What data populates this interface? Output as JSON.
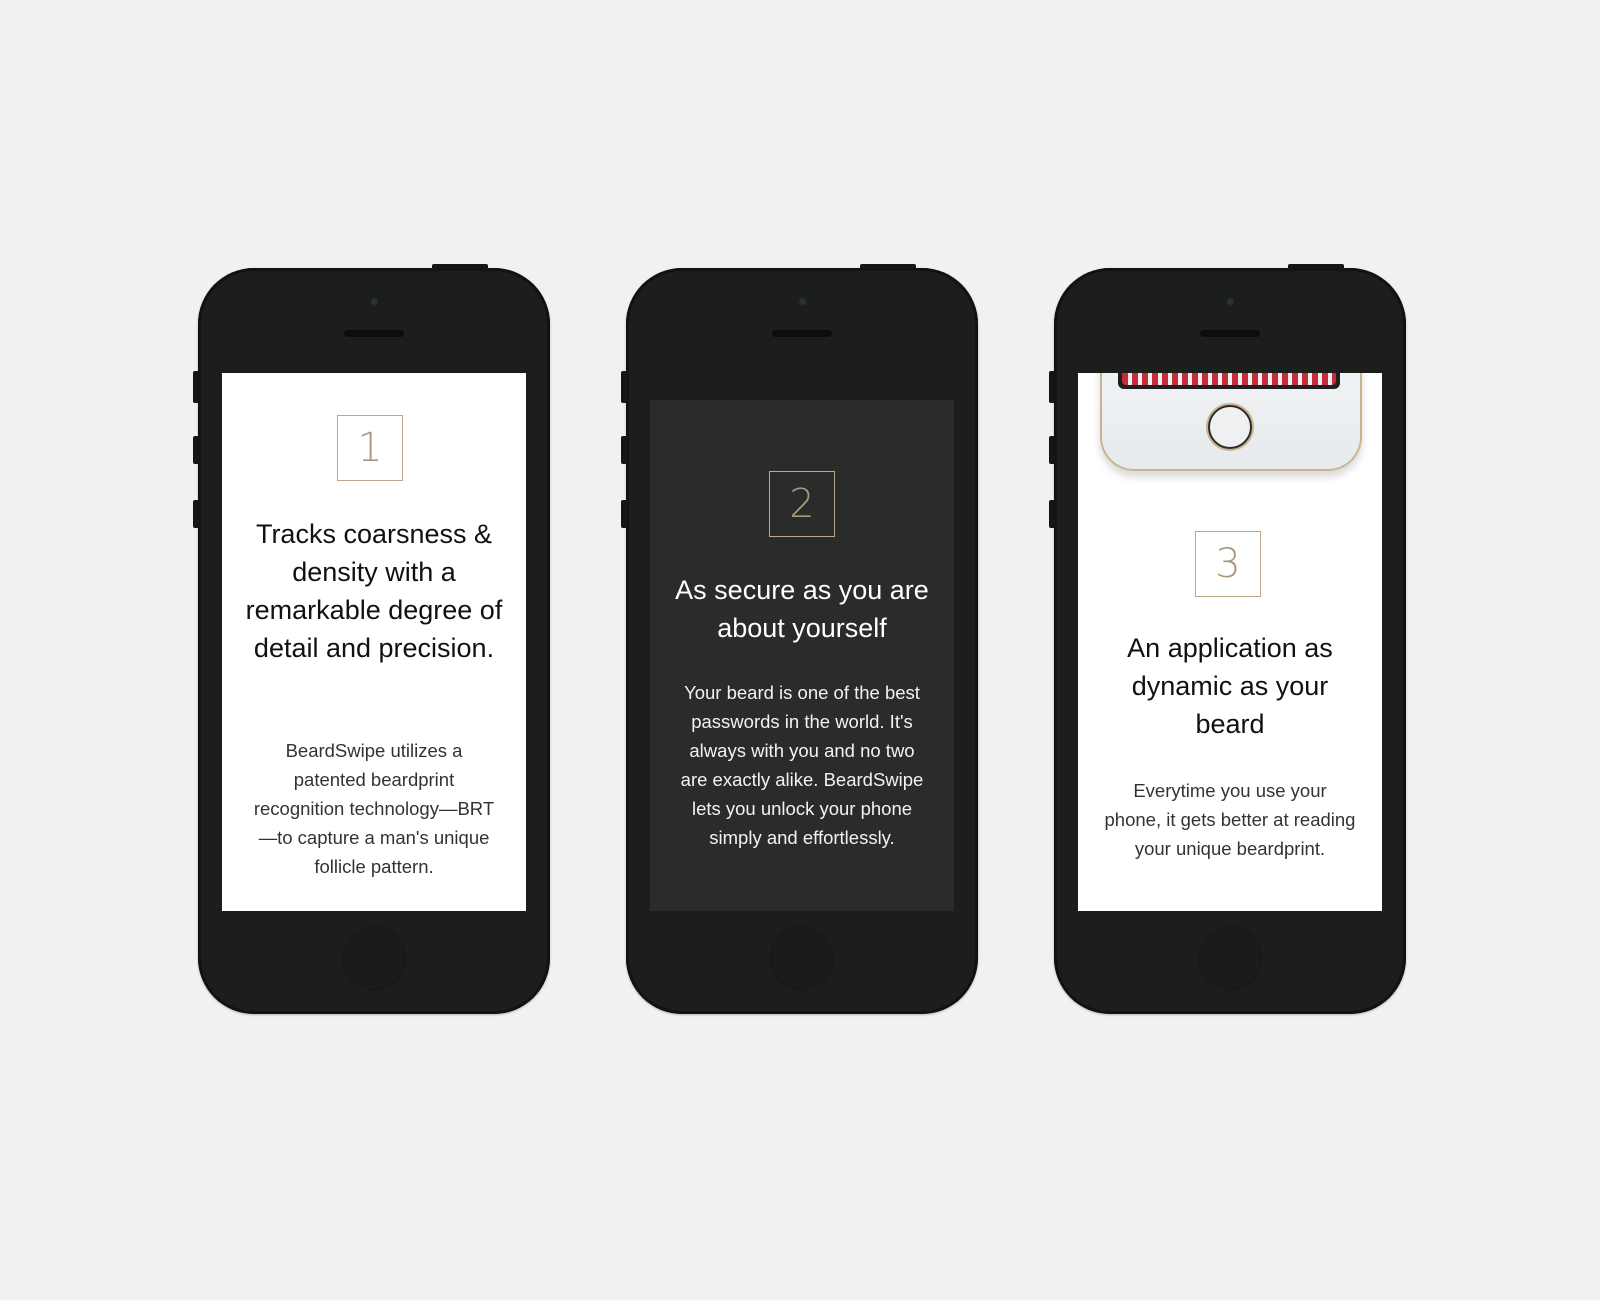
{
  "phones": [
    {
      "step": "1",
      "heading": "Tracks coarsness & density with a remarkable degree of detail and precision.",
      "body": "BeardSwipe utilizes a patented beardprint recognition technology—BRT—to capture a man's unique follicle pattern."
    },
    {
      "step": "2",
      "heading": "As secure as you are about yourself",
      "body": "Your beard is one of the best passwords in the world. It's always with you and no two are exactly alike. BeardSwipe lets you unlock your phone simply and effortlessly."
    },
    {
      "step": "3",
      "heading": "An application as dynamic as your beard",
      "body": "Everytime you use your phone, it gets better at reading your unique beardprint."
    }
  ],
  "colors": {
    "background": "#f0f1f3",
    "phone_body": "#1c1e1c",
    "dark_panel": "#2a2b2b",
    "accent_gold": "#b9a88a"
  }
}
